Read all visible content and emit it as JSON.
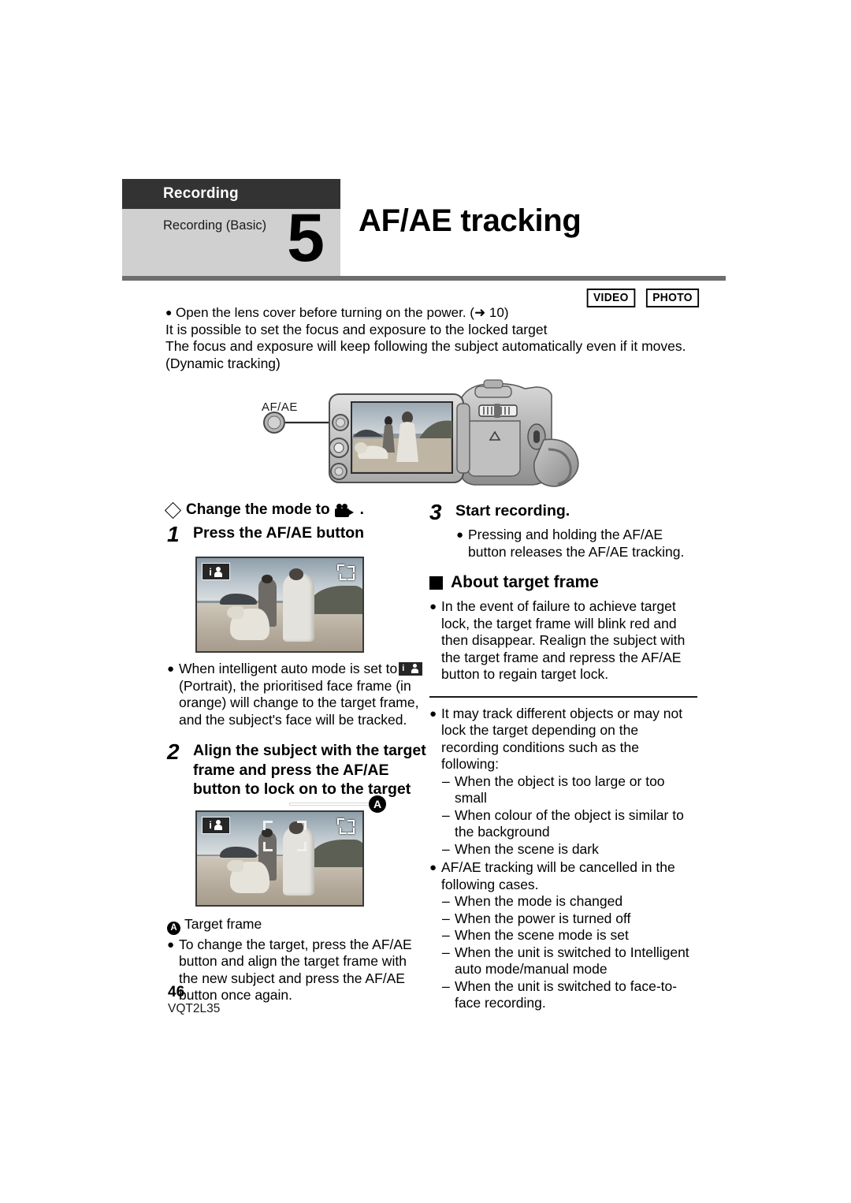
{
  "header": {
    "chapter": "Recording",
    "section": "Recording (Basic)",
    "number": "5",
    "title": "AF/AE tracking"
  },
  "badges": [
    {
      "label": "VIDEO",
      "name": "video-badge"
    },
    {
      "label": "PHOTO",
      "name": "photo-badge"
    }
  ],
  "intro": {
    "bullet_line": "Open the lens cover before turning on the power. (➜ 10)",
    "line2": "It is possible to set the focus and exposure to the locked target",
    "line3": "The focus and exposure will keep following the subject automatically even if it moves.",
    "line4": "(Dynamic tracking)"
  },
  "illustration": {
    "button_label": "AF/AE",
    "alt": "Camcorder with LCD monitor open showing recording preview and AF/AE button"
  },
  "left_column": {
    "mode_line": "Change the mode to",
    "mode_line_suffix": ".",
    "step1": {
      "number": "1",
      "text": "Press the AF/AE button"
    },
    "screen1": {
      "ia_icon": "intelligent-auto-portrait-icon",
      "afae_icon": "afae-target-icon"
    },
    "note1": {
      "bullet": "●",
      "text_before_icon": "When intelligent auto mode is set to",
      "text_after_icon": "(Portrait), the prioritised face frame (in orange) will change to the target frame, and the subject's face will be tracked."
    },
    "step2": {
      "number": "2",
      "text": "Align the subject with the target frame and press the AF/AE button to lock on to the target"
    },
    "screen2": {
      "callout_label": "A"
    },
    "callout_caption": "Target frame",
    "note2": {
      "bullet": "●",
      "text": "To change the target, press the AF/AE button and align the target frame with the new subject and press the AF/AE button once again."
    }
  },
  "right_column": {
    "step3": {
      "number": "3",
      "text": "Start recording."
    },
    "note3": {
      "bullet": "●",
      "text": "Pressing and holding the AF/AE button releases the AF/AE tracking."
    },
    "subhead": "About target frame",
    "note4": {
      "bullet": "●",
      "text": "In the event of failure to achieve target lock, the target frame will blink red and then disappear. Realign the subject with the target frame and repress the AF/AE button to regain target lock."
    },
    "note5": {
      "bullet": "●",
      "text": "It may track different objects or may not lock the target depending on the recording conditions such as the following:"
    },
    "conditions": [
      "When the object is too large or too small",
      "When colour of the object is similar to",
      "the background",
      "When the scene is dark"
    ],
    "note6": {
      "bullet": "●",
      "text": "AF/AE tracking will be cancelled in the following cases."
    },
    "cancel_cases": [
      "When the mode is changed",
      "When the power is turned off",
      "When the scene mode is set",
      "When the unit is switched to Intelligent",
      "auto mode/manual mode",
      "When the unit is switched to face-to-",
      "face recording."
    ]
  },
  "footer": {
    "page_number": "46",
    "document_code": "VQT2L35"
  },
  "colors": {
    "chapter_bar": "#333333",
    "section_block": "#d0d0d0",
    "rule": "#6e6e6e",
    "text": "#000000"
  }
}
